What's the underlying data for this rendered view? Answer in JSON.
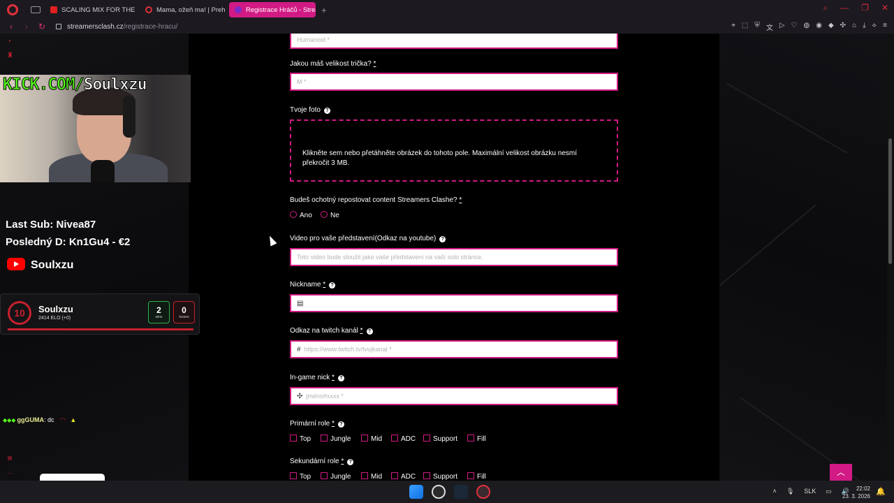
{
  "browser": {
    "tabs": [
      {
        "title": "SCALING MIX FOR THE LV",
        "favicon_color": "#e02020"
      },
      {
        "title": "Mama, ožeň ma! | Prehľad",
        "favicon_color": "#e0303a"
      },
      {
        "title": "Registrace Hráčů - Stream",
        "favicon_color": "#7a2cc9",
        "active": true
      }
    ],
    "url_host": "streamersclash.cz",
    "url_path": "/registrace-hracu/",
    "accent": "#d21a84"
  },
  "form": {
    "top_input_placeholder": "Humanoid *",
    "shirt_label": "Jakou máš velikost trička?",
    "shirt_placeholder": "M *",
    "photo_label": "Tvoje foto",
    "photo_dropzone_text": "Klikněte sem nebo přetáhněte obrázek do tohoto pole. Maximální velikost obrázku nesmí překročit 3 MB.",
    "repost_label": "Budeš ochotný repostovat content Streamers Clashe?",
    "repost_options": [
      "Ano",
      "Ne"
    ],
    "video_label": "Video pro vaše představení(Odkaz na youtube)",
    "video_placeholder": "Toto video bude sloužit jako vaše představení na vaší solo stránce.",
    "nickname_label": "Nickname",
    "nickname_value": "",
    "twitch_label": "Odkaz na twitch kanál",
    "twitch_placeholder": "https://www.twitch.tv/tvujkanal *",
    "ingame_label": "In-game nick",
    "ingame_placeholder": "jméno#xxxx *",
    "primary_role_label": "Primární role",
    "secondary_role_label": "Sekundární role",
    "roles": [
      "Top",
      "Jungle",
      "Mid",
      "ADC",
      "Support",
      "Fill"
    ],
    "required_mark": "*",
    "help_glyph": "?"
  },
  "overlay": {
    "kick_prefix": "KICK.COM/",
    "kick_name": "Soulxzu",
    "last_sub": "Last Sub: Nivea87",
    "last_donation": "Posledný D: Kn1Gu4 - €2",
    "youtube_name": "Soulxzu",
    "elo_level": "10",
    "elo_name": "Soulxzu",
    "elo_detail": "2414 ELO (+0)",
    "wins": "2",
    "wins_label": "wins",
    "losses": "0",
    "losses_label": "losses",
    "chat_user": "ggGUMA",
    "chat_message": ": dc"
  },
  "taskbar": {
    "lang": "SLK",
    "time": "22:02",
    "date": "23. 3. 2026"
  }
}
